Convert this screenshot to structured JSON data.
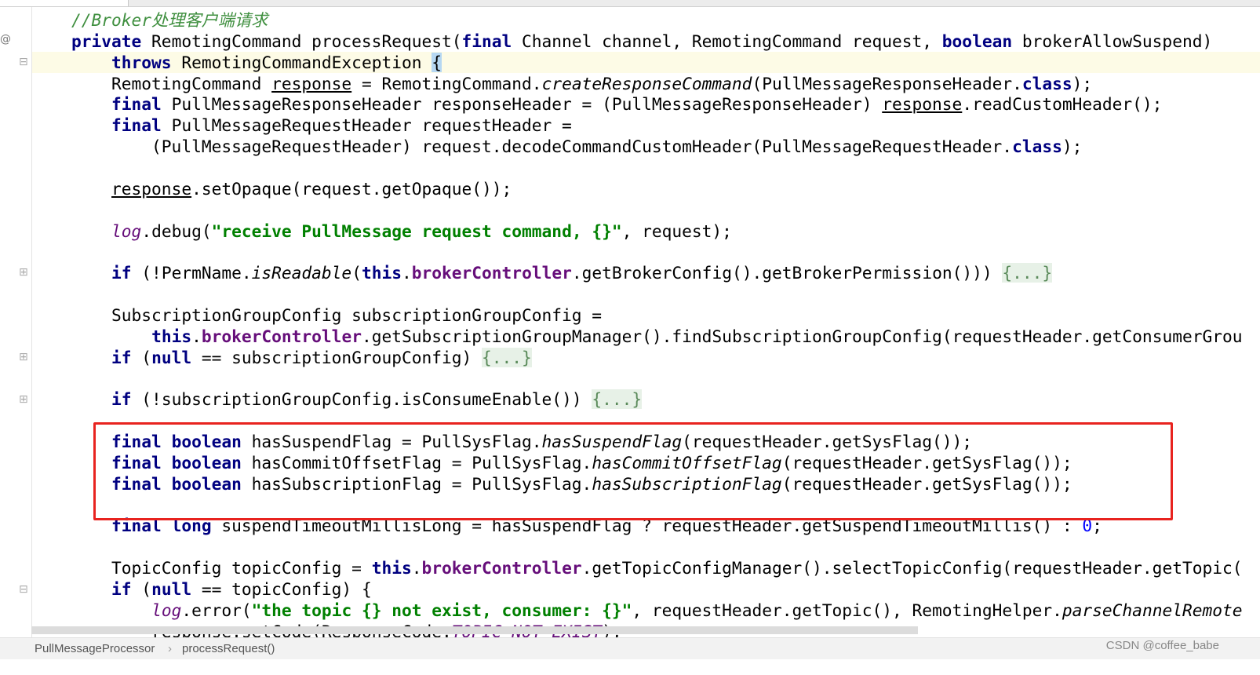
{
  "colors": {
    "keyword": "#000080",
    "string": "#008000",
    "field": "#660e7a",
    "number": "#0000ff",
    "highlight_box": "#e8231f"
  },
  "gutter_icons": [
    "override-icon",
    "fold-icon"
  ],
  "code_lines": [
    [
      [
        "c",
        "//Broker处理客户端请求"
      ]
    ],
    [
      [
        "k",
        "private"
      ],
      [
        "p",
        " RemotingCommand processRequest("
      ],
      [
        "k",
        "final"
      ],
      [
        "p",
        " Channel channel, RemotingCommand request, "
      ],
      [
        "k",
        "boolean"
      ],
      [
        "p",
        " brokerAllowSuspend)"
      ]
    ],
    [
      [
        "p",
        "    "
      ],
      [
        "k",
        "throws"
      ],
      [
        "p",
        " RemotingCommandException "
      ],
      [
        "br",
        "{"
      ]
    ],
    [
      [
        "p",
        "    RemotingCommand "
      ],
      [
        "u",
        "response"
      ],
      [
        "p",
        " = RemotingCommand."
      ],
      [
        "i",
        "createResponseCommand"
      ],
      [
        "p",
        "(PullMessageResponseHeader."
      ],
      [
        "k",
        "class"
      ],
      [
        "p",
        ");"
      ]
    ],
    [
      [
        "p",
        "    "
      ],
      [
        "k",
        "final"
      ],
      [
        "p",
        " PullMessageResponseHeader responseHeader = (PullMessageResponseHeader) "
      ],
      [
        "u",
        "response"
      ],
      [
        "p",
        ".readCustomHeader();"
      ]
    ],
    [
      [
        "p",
        "    "
      ],
      [
        "k",
        "final"
      ],
      [
        "p",
        " PullMessageRequestHeader requestHeader ="
      ]
    ],
    [
      [
        "p",
        "        (PullMessageRequestHeader) request.decodeCommandCustomHeader(PullMessageRequestHeader."
      ],
      [
        "k",
        "class"
      ],
      [
        "p",
        ");"
      ]
    ],
    [],
    [
      [
        "p",
        "    "
      ],
      [
        "u",
        "response"
      ],
      [
        "p",
        ".setOpaque(request.getOpaque());"
      ]
    ],
    [],
    [
      [
        "p",
        "    "
      ],
      [
        "fi",
        "log"
      ],
      [
        "p",
        ".debug("
      ],
      [
        "s",
        "\"receive PullMessage request command, {}\""
      ],
      [
        "p",
        ", request);"
      ]
    ],
    [],
    [
      [
        "p",
        "    "
      ],
      [
        "k",
        "if"
      ],
      [
        "p",
        " (!PermName."
      ],
      [
        "i",
        "isReadable"
      ],
      [
        "p",
        "("
      ],
      [
        "k",
        "this"
      ],
      [
        "p",
        "."
      ],
      [
        "f",
        "brokerController"
      ],
      [
        "p",
        ".getBrokerConfig().getBrokerPermission())) "
      ],
      [
        "fold",
        "{...}"
      ]
    ],
    [],
    [
      [
        "p",
        "    SubscriptionGroupConfig subscriptionGroupConfig ="
      ]
    ],
    [
      [
        "p",
        "        "
      ],
      [
        "k",
        "this"
      ],
      [
        "p",
        "."
      ],
      [
        "f",
        "brokerController"
      ],
      [
        "p",
        ".getSubscriptionGroupManager().findSubscriptionGroupConfig(requestHeader.getConsumerGrou"
      ]
    ],
    [
      [
        "p",
        "    "
      ],
      [
        "k",
        "if"
      ],
      [
        "p",
        " ("
      ],
      [
        "k",
        "null"
      ],
      [
        "p",
        " == subscriptionGroupConfig) "
      ],
      [
        "fold",
        "{...}"
      ]
    ],
    [],
    [
      [
        "p",
        "    "
      ],
      [
        "k",
        "if"
      ],
      [
        "p",
        " (!subscriptionGroupConfig.isConsumeEnable()) "
      ],
      [
        "fold",
        "{...}"
      ]
    ],
    [],
    [
      [
        "p",
        "    "
      ],
      [
        "k",
        "final boolean"
      ],
      [
        "p",
        " hasSuspendFlag = PullSysFlag."
      ],
      [
        "i",
        "hasSuspendFlag"
      ],
      [
        "p",
        "(requestHeader.getSysFlag());"
      ]
    ],
    [
      [
        "p",
        "    "
      ],
      [
        "k",
        "final boolean"
      ],
      [
        "p",
        " hasCommitOffsetFlag = PullSysFlag."
      ],
      [
        "i",
        "hasCommitOffsetFlag"
      ],
      [
        "p",
        "(requestHeader.getSysFlag());"
      ]
    ],
    [
      [
        "p",
        "    "
      ],
      [
        "k",
        "final boolean"
      ],
      [
        "p",
        " hasSubscriptionFlag = PullSysFlag."
      ],
      [
        "i",
        "hasSubscriptionFlag"
      ],
      [
        "p",
        "(requestHeader.getSysFlag());"
      ]
    ],
    [],
    [
      [
        "p",
        "    "
      ],
      [
        "k",
        "final long"
      ],
      [
        "p",
        " suspendTimeoutMillisLong = hasSuspendFlag ? requestHeader.getSuspendTimeoutMillis() : "
      ],
      [
        "n",
        "0"
      ],
      [
        "p",
        ";"
      ]
    ],
    [],
    [
      [
        "p",
        "    TopicConfig topicConfig = "
      ],
      [
        "k",
        "this"
      ],
      [
        "p",
        "."
      ],
      [
        "f",
        "brokerController"
      ],
      [
        "p",
        ".getTopicConfigManager().selectTopicConfig(requestHeader.getTopic("
      ]
    ],
    [
      [
        "p",
        "    "
      ],
      [
        "k",
        "if"
      ],
      [
        "p",
        " ("
      ],
      [
        "k",
        "null"
      ],
      [
        "p",
        " == topicConfig) {"
      ]
    ],
    [
      [
        "p",
        "        "
      ],
      [
        "fi",
        "log"
      ],
      [
        "p",
        ".error("
      ],
      [
        "s",
        "\"the topic {} not exist, consumer: {}\""
      ],
      [
        "p",
        ", requestHeader.getTopic(), RemotingHelper."
      ],
      [
        "i",
        "parseChannelRemote"
      ]
    ],
    [
      [
        "p",
        "        "
      ],
      [
        "u",
        "response"
      ],
      [
        "p",
        ".setCode(ResponseCode."
      ],
      [
        "fi",
        "TOPIC_NOT_EXIST"
      ],
      [
        "p",
        ");"
      ]
    ]
  ],
  "breadcrumb": [
    "PullMessageProcessor",
    "processRequest()"
  ],
  "breadcrumb_separator": "›",
  "watermark": "CSDN @coffee_babe"
}
